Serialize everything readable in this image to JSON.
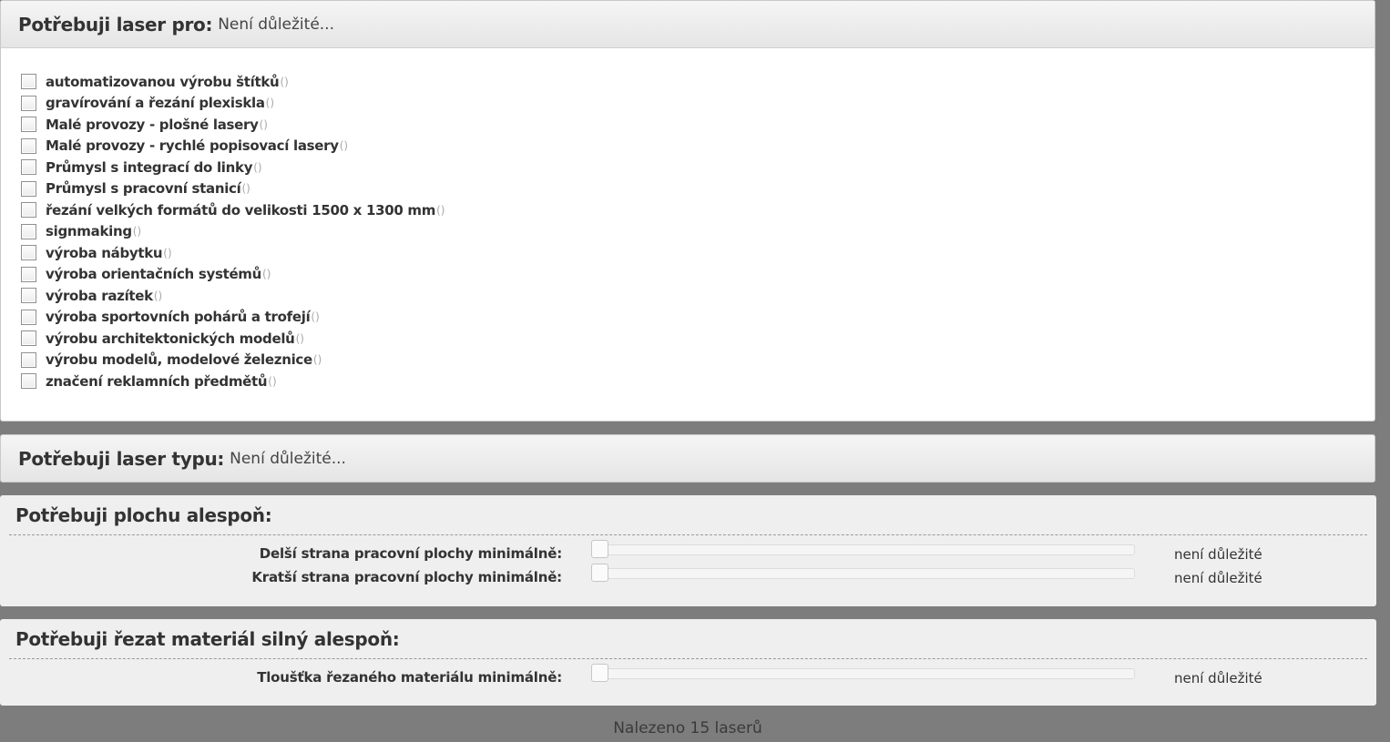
{
  "use_filter": {
    "title": "Potřebuji laser pro:",
    "value": "Není důležité...",
    "items": [
      {
        "label": "automatizovanou výrobu štítků",
        "count": "()"
      },
      {
        "label": "gravírování a řezání plexiskla",
        "count": "()"
      },
      {
        "label": "Malé provozy - plošné lasery",
        "count": "()"
      },
      {
        "label": "Malé provozy - rychlé popisovací lasery",
        "count": "()"
      },
      {
        "label": "Průmysl s integrací do linky",
        "count": "()"
      },
      {
        "label": "Průmysl s pracovní stanicí",
        "count": "()"
      },
      {
        "label": "řezání velkých formátů do velikosti 1500 x 1300 mm",
        "count": "()"
      },
      {
        "label": "signmaking",
        "count": "()"
      },
      {
        "label": "výroba nábytku",
        "count": "()"
      },
      {
        "label": "výroba orientačních systémů",
        "count": "()"
      },
      {
        "label": "výroba razítek",
        "count": "()"
      },
      {
        "label": "výroba sportovních pohárů a trofejí",
        "count": "()"
      },
      {
        "label": "výrobu architektonických modelů",
        "count": "()"
      },
      {
        "label": "výrobu modelů, modelové železnice ",
        "count": "()"
      },
      {
        "label": "značení reklamních předmětů",
        "count": "()"
      }
    ]
  },
  "type_filter": {
    "title": "Potřebuji laser typu:",
    "value": "Není důležité..."
  },
  "area_filter": {
    "title": "Potřebuji plochu alespoň:",
    "sliders": [
      {
        "label": "Delší strana pracovní plochy minimálně:",
        "value": "není důležité",
        "level": 0
      },
      {
        "label": "Kratší strana pracovní plochy minimálně:",
        "value": "není důležité",
        "level": 0
      }
    ]
  },
  "material_filter": {
    "title": "Potřebuji řezat materiál silný alespoň:",
    "sliders": [
      {
        "label": "Tloušťka řezaného materiálu minimálně:",
        "value": "není důležité",
        "level": 0
      }
    ]
  },
  "results": {
    "count_text": "Nalezeno 15 laserů"
  }
}
